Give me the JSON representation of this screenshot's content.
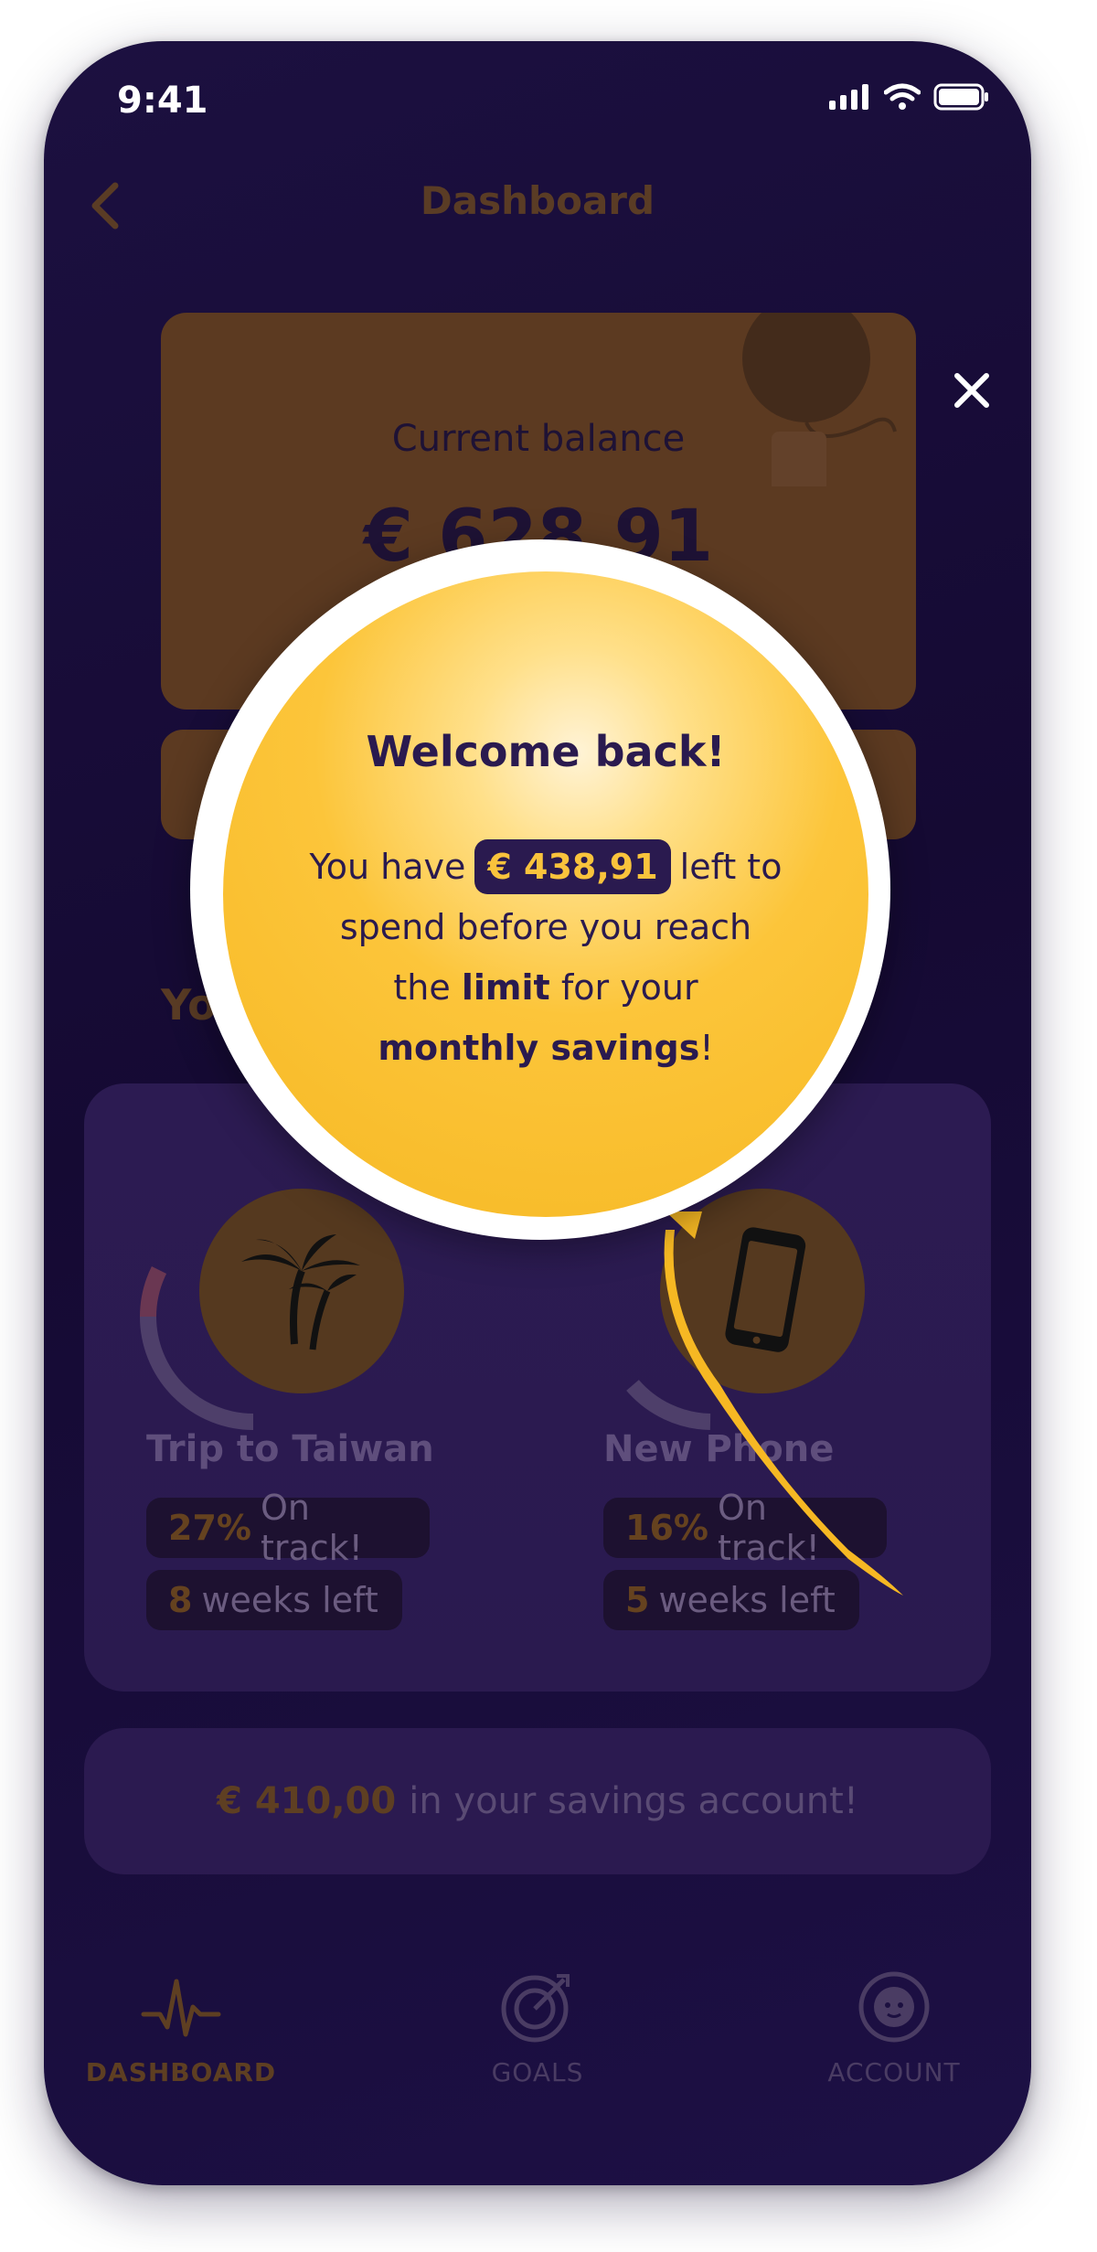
{
  "status_bar": {
    "time": "9:41"
  },
  "header": {
    "title": "Dashboard"
  },
  "balance": {
    "label": "Current balance",
    "value": "€ 628,91"
  },
  "goals_section": {
    "title": "Yo"
  },
  "goals": [
    {
      "name": "Trip to Taiwan",
      "percent": "27%",
      "status": "On track!",
      "weeks": "8",
      "weeks_label": "weeks left",
      "icon": "palm-tree-icon"
    },
    {
      "name": "New Phone",
      "percent": "16%",
      "status": "On track!",
      "weeks": "5",
      "weeks_label": "weeks left",
      "icon": "phone-icon"
    }
  ],
  "savings": {
    "amount": "€ 410,00",
    "text": "in your savings account!"
  },
  "tabs": [
    {
      "label": "DASHBOARD",
      "icon": "pulse-icon",
      "active": true
    },
    {
      "label": "GOALS",
      "icon": "target-icon",
      "active": false
    },
    {
      "label": "ACCOUNT",
      "icon": "face-icon",
      "active": false
    }
  ],
  "popup": {
    "title": "Welcome back!",
    "text_before": "You have",
    "amount": "€ 438,91",
    "text_after": "left to",
    "line2": "spend before you reach",
    "line3_pre": "the",
    "line3_bold": "limit",
    "line3_post": "for your",
    "line4_bold": "monthly savings",
    "line4_post": "!"
  },
  "colors": {
    "accent": "#f9c33c",
    "background": "#1c1040",
    "card_brown": "#5c3a21"
  }
}
